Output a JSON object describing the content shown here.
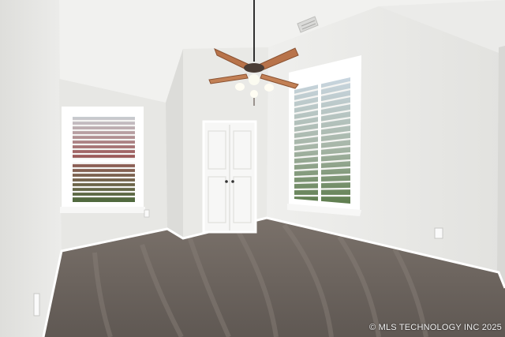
{
  "photo": {
    "watermark": "© MLS TECHNOLOGY INC 2025"
  },
  "colors": {
    "wall_light": "#eeeeec",
    "wall_shadow": "#d6d6d3",
    "ceiling": "#f1f1ef",
    "trim": "#ffffff",
    "carpet": "#6e6660",
    "fan_blade": "#b8734a"
  },
  "icons": [
    "ceiling-fan-icon",
    "window-blinds-icon",
    "door-icon",
    "outlet-icon",
    "ceiling-vent-icon"
  ]
}
